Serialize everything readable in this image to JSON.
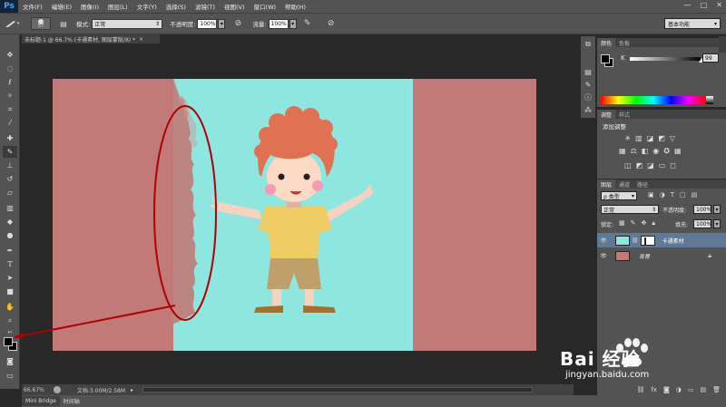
{
  "app": {
    "logo": "Ps"
  },
  "menu": {
    "items": [
      "文件(F)",
      "编辑(E)",
      "图像(I)",
      "图层(L)",
      "文字(Y)",
      "选择(S)",
      "滤镜(T)",
      "视图(V)",
      "窗口(W)",
      "帮助(H)"
    ],
    "window_controls": [
      "—",
      "□",
      "✕"
    ]
  },
  "options": {
    "brush_size": "57",
    "mode_label": "模式:",
    "mode_value": "正常",
    "opacity_label": "不透明度:",
    "opacity_value": "100%",
    "flow_label": "流量:",
    "flow_value": "100%",
    "workspace": "基本功能"
  },
  "document": {
    "tab_title": "未标题-1 @ 66.7% (卡通素材, 图层蒙版/8) *",
    "tab_close": "×",
    "zoom": "66.67%",
    "doc_info": "文档:3.00M/2.58M"
  },
  "bottom_tabs": [
    "Mini Bridge",
    "时间轴"
  ],
  "color_panel": {
    "tabs": [
      "颜色",
      "色板"
    ],
    "channel_label": "K",
    "channel_value": "99"
  },
  "adjust_panel": {
    "tabs": [
      "调整",
      "样式"
    ],
    "title": "添加调整"
  },
  "layers_panel": {
    "tabs": [
      "图层",
      "通道",
      "路径"
    ],
    "kind_label": "ρ 类型",
    "blend_mode": "正常",
    "opacity_label": "不透明度:",
    "opacity_value": "100%",
    "lock_label": "锁定:",
    "fill_label": "填充:",
    "fill_value": "100%",
    "layers": [
      {
        "name": "卡通素材",
        "selected": true
      },
      {
        "name": "背景",
        "selected": false
      }
    ]
  },
  "watermark": {
    "brand": "Bai 经验",
    "url": "jingyan.baidu.com"
  },
  "colors": {
    "canvas_cyan": "#8de6e0",
    "canvas_rose": "#c27a78",
    "annotation_red": "#b00000",
    "layer_selected": "#5f7a97"
  }
}
